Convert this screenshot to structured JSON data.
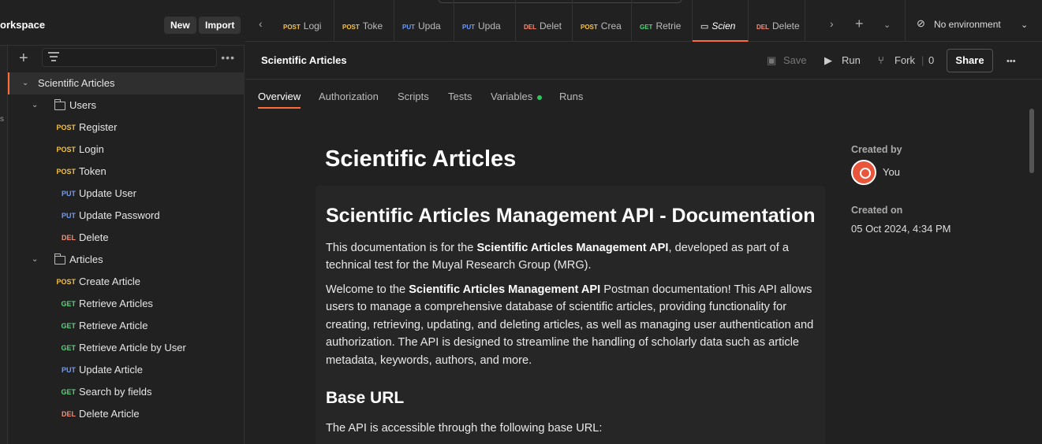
{
  "workspace": {
    "title": "orkspace",
    "new_label": "New",
    "import_label": "Import"
  },
  "rail": {
    "text": "s"
  },
  "sidebar": {
    "collection": "Scientific Articles",
    "folders": [
      {
        "name": "Users",
        "items": [
          {
            "method": "POST",
            "label": "Register"
          },
          {
            "method": "POST",
            "label": "Login"
          },
          {
            "method": "POST",
            "label": "Token"
          },
          {
            "method": "PUT",
            "label": "Update User"
          },
          {
            "method": "PUT",
            "label": "Update Password"
          },
          {
            "method": "DEL",
            "label": "Delete"
          }
        ]
      },
      {
        "name": "Articles",
        "items": [
          {
            "method": "POST",
            "label": "Create Article"
          },
          {
            "method": "GET",
            "label": "Retrieve Articles"
          },
          {
            "method": "GET",
            "label": "Retrieve Article"
          },
          {
            "method": "GET",
            "label": "Retrieve Article by User"
          },
          {
            "method": "PUT",
            "label": "Update Article"
          },
          {
            "method": "GET",
            "label": "Search by fields"
          },
          {
            "method": "DEL",
            "label": "Delete Article"
          }
        ]
      }
    ]
  },
  "tabs": [
    {
      "method": "POST",
      "name": "Logi"
    },
    {
      "method": "POST",
      "name": "Toke"
    },
    {
      "method": "PUT",
      "name": "Upda"
    },
    {
      "method": "PUT",
      "name": "Upda"
    },
    {
      "method": "DEL",
      "name": "Delet"
    },
    {
      "method": "POST",
      "name": "Crea"
    },
    {
      "method": "GET",
      "name": "Retrie"
    },
    {
      "method": "",
      "name": "Scien"
    },
    {
      "method": "DEL",
      "name": "Delete"
    }
  ],
  "environment": "No environment",
  "header": {
    "title": "Scientific Articles",
    "save": "Save",
    "run": "Run",
    "fork": "Fork",
    "fork_count": "0",
    "share": "Share"
  },
  "subtabs": [
    "Overview",
    "Authorization",
    "Scripts",
    "Tests",
    "Variables",
    "Runs"
  ],
  "doc": {
    "title": "Scientific Articles",
    "h2": "Scientific Articles Management API - Documentation",
    "p1_a": "This documentation is for the ",
    "p1_b": "Scientific Articles Management API",
    "p1_c": ", developed as part of a technical test for the Muyal Research Group (MRG).",
    "p2_a": "Welcome to the ",
    "p2_b": "Scientific Articles Management API",
    "p2_c": " Postman documentation! This API allows users to manage a comprehensive database of scientific articles, providing functionality for creating, retrieving, updating, and deleting articles, as well as managing user authentication and authorization. The API is designed to streamline the handling of scholarly data such as article metadata, keywords, authors, and more.",
    "h3": "Base URL",
    "p3": "The API is accessible through the following base URL:"
  },
  "meta": {
    "created_by_label": "Created by",
    "created_by": "You",
    "created_on_label": "Created on",
    "created_on": "05 Oct 2024, 4:34 PM"
  }
}
